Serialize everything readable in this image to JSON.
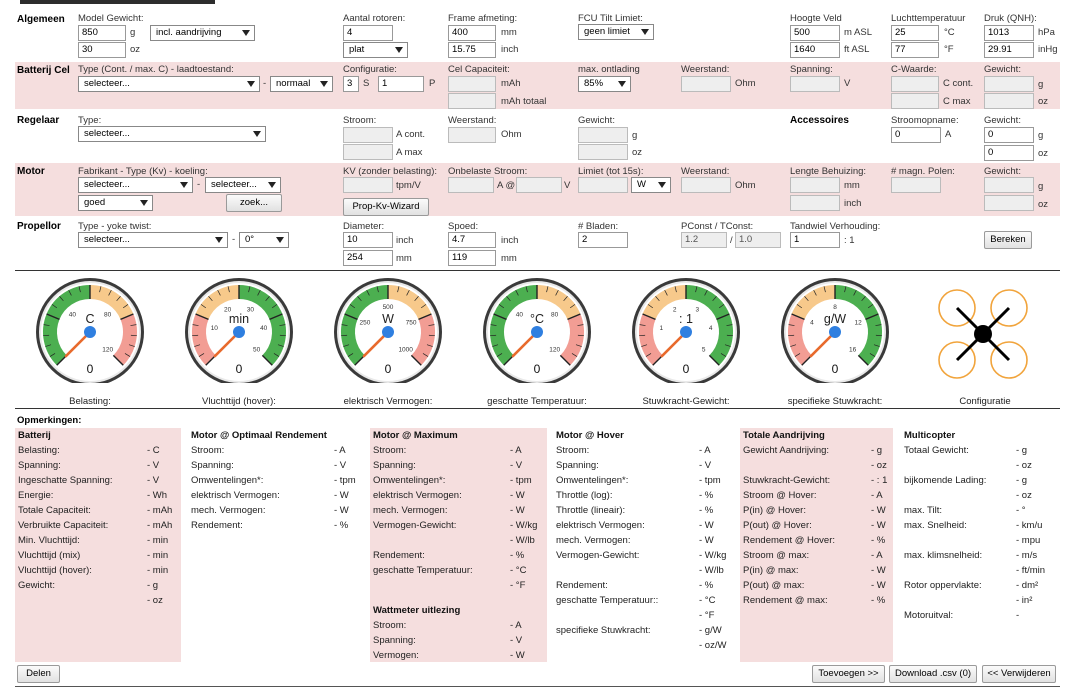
{
  "sections": {
    "general": "Algemeen",
    "battery": "Batterij Cel",
    "controller": "Regelaar",
    "motor": "Motor",
    "propeller": "Propellor",
    "accessories": "Accessoires"
  },
  "general": {
    "model_weight_label": "Model Gewicht:",
    "weight_g": "850",
    "weight_unit_g": "g",
    "weight_mode": "incl. aandrijving",
    "weight_oz": "30",
    "weight_unit_oz": "oz",
    "rotors_label": "Aantal rotoren:",
    "rotors": "4",
    "rotor_layout": "plat",
    "frame_label": "Frame afmeting:",
    "frame_mm": "400",
    "frame_mm_unit": "mm",
    "frame_inch": "15.75",
    "frame_inch_unit": "inch",
    "fcu_label": "FCU Tilt Limiet:",
    "fcu_value": "geen limiet",
    "field_label": "Hoogte Veld",
    "field_m": "500",
    "field_m_unit": "m ASL",
    "field_ft": "1640",
    "field_ft_unit": "ft ASL",
    "temp_label": "Luchttemperatuur",
    "temp_c": "25",
    "temp_c_unit": "°C",
    "temp_f": "77",
    "temp_f_unit": "°F",
    "pressure_label": "Druk (QNH):",
    "pressure_hpa": "1013",
    "pressure_hpa_unit": "hPa",
    "pressure_inhg": "29.91",
    "pressure_inhg_unit": "inHg"
  },
  "battery": {
    "type_label": "Type (Cont. / max. C) - laadtoestand:",
    "type_value": "selecteer...",
    "dash": "-",
    "charge_state": "normaal",
    "config_label": "Configuratie:",
    "cells_s": "3",
    "s_unit": "S",
    "cells_p": "1",
    "p_unit": "P",
    "capacity_label": "Cel Capaciteit:",
    "cap_unit": "mAh",
    "cap_total_unit": "mAh totaal",
    "discharge_label": "max. ontlading",
    "discharge_value": "85%",
    "resistance_label": "Weerstand:",
    "resistance_unit": "Ohm",
    "voltage_label": "Spanning:",
    "voltage_unit": "V",
    "c_label": "C-Waarde:",
    "c_cont_unit": "C cont.",
    "c_max_unit": "C max",
    "weight_label": "Gewicht:",
    "weight_unit_g": "g",
    "weight_unit_oz": "oz"
  },
  "controller": {
    "type_label": "Type:",
    "type_value": "selecteer...",
    "current_label": "Stroom:",
    "cont_unit": "A cont.",
    "max_unit": "A max",
    "resistance_label": "Weerstand:",
    "resistance_unit": "Ohm",
    "weight_label": "Gewicht:",
    "weight_unit_g": "g",
    "weight_unit_oz": "oz"
  },
  "accessories": {
    "current_label": "Stroomopname:",
    "current": "0",
    "current_unit": "A",
    "weight_label": "Gewicht:",
    "weight_g": "0",
    "weight_unit_g": "g",
    "weight_oz": "0",
    "weight_unit_oz": "oz"
  },
  "motor": {
    "type_label": "Fabrikant - Type (Kv) - koeling:",
    "manufacturer": "selecteer...",
    "dash": "-",
    "type_value": "selecteer...",
    "cooling": "goed",
    "search_button": "zoek...",
    "kv_label": "KV (zonder belasting):",
    "kv_unit": "tpm/V",
    "wizard_button": "Prop-Kv-Wizard",
    "noload_label": "Onbelaste Stroom:",
    "noload_a_unit": "A @",
    "noload_v_unit": "V",
    "limit_label": "Limiet (tot 15s):",
    "limit_unit": "W",
    "resistance_label": "Weerstand:",
    "resistance_unit": "Ohm",
    "length_label": "Lengte Behuizing:",
    "length_mm_unit": "mm",
    "length_inch_unit": "inch",
    "poles_label": "# magn. Polen:",
    "weight_label": "Gewicht:",
    "weight_unit_g": "g",
    "weight_unit_oz": "oz"
  },
  "propeller": {
    "type_label": "Type - yoke twist:",
    "type_value": "selecteer...",
    "dash": "-",
    "twist": "0°",
    "diameter_label": "Diameter:",
    "diameter_inch": "10",
    "diameter_inch_unit": "inch",
    "diameter_mm": "254",
    "diameter_mm_unit": "mm",
    "pitch_label": "Spoed:",
    "pitch_inch": "4.7",
    "pitch_inch_unit": "inch",
    "pitch_mm": "119",
    "pitch_mm_unit": "mm",
    "blades_label": "# Bladen:",
    "blades": "2",
    "pconst_label": "PConst / TConst:",
    "pconst": "1.2",
    "slash": "/",
    "tconst": "1.0",
    "gear_label": "Tandwiel Verhouding:",
    "gear": "1",
    "gear_unit": ": 1",
    "calc_button": "Bereken"
  },
  "gauges": [
    {
      "unit": "C",
      "value": "0",
      "caption": "Belasting:",
      "ticks": [
        "40",
        "80",
        "120"
      ],
      "colors": [
        "#4caf50",
        "#4caf50",
        "#f7c98b",
        "#f29d94"
      ]
    },
    {
      "unit": "min",
      "value": "0",
      "caption": "Vluchttijd (hover):",
      "ticks": [
        "10",
        "20",
        "30",
        "40",
        "50"
      ],
      "colors": [
        "#f29d94",
        "#f7c98b",
        "#4caf50",
        "#4caf50"
      ]
    },
    {
      "unit": "W",
      "value": "0",
      "caption": "elektrisch Vermogen:",
      "ticks": [
        "250",
        "500",
        "750",
        "1000"
      ],
      "colors": [
        "#4caf50",
        "#4caf50",
        "#f7c98b",
        "#f29d94"
      ]
    },
    {
      "unit": "°C",
      "value": "0",
      "caption": "geschatte Temperatuur:",
      "ticks": [
        "40",
        "80",
        "120"
      ],
      "colors": [
        "#4caf50",
        "#4caf50",
        "#f7c98b",
        "#f29d94"
      ]
    },
    {
      "unit": ": 1",
      "value": "0",
      "caption": "Stuwkracht-Gewicht:",
      "ticks": [
        "1",
        "2",
        "3",
        "4",
        "5"
      ],
      "colors": [
        "#f29d94",
        "#f7c98b",
        "#4caf50",
        "#4caf50"
      ]
    },
    {
      "unit": "g/W",
      "value": "0",
      "caption": "specifieke Stuwkracht:",
      "ticks": [
        "4",
        "8",
        "12",
        "16"
      ],
      "colors": [
        "#f29d94",
        "#f7c98b",
        "#4caf50",
        "#4caf50"
      ]
    }
  ],
  "config_caption": "Configuratie",
  "remarks_label": "Opmerkingen:",
  "results": [
    {
      "title": "Batterij",
      "pink": true,
      "rows": [
        {
          "k": "Belasting:",
          "v": "- C"
        },
        {
          "k": "Spanning:",
          "v": "- V"
        },
        {
          "k": "Ingeschatte Spanning:",
          "v": "- V"
        },
        {
          "k": "Energie:",
          "v": "- Wh"
        },
        {
          "k": "Totale Capaciteit:",
          "v": "- mAh"
        },
        {
          "k": "Verbruikte Capaciteit:",
          "v": "- mAh"
        },
        {
          "k": "Min. Vluchttijd:",
          "v": "- min"
        },
        {
          "k": "Vluchttijd (mix)",
          "v": "- min"
        },
        {
          "k": "Vluchttijd (hover):",
          "v": "- min"
        },
        {
          "k": "Gewicht:",
          "v": "- g"
        },
        {
          "k": "",
          "v": "- oz"
        }
      ]
    },
    {
      "title": "Motor @ Optimaal Rendement",
      "pink": false,
      "rows": [
        {
          "k": "Stroom:",
          "v": "- A"
        },
        {
          "k": "Spanning:",
          "v": "- V"
        },
        {
          "k": "Omwentelingen*:",
          "v": "- tpm"
        },
        {
          "k": "elektrisch Vermogen:",
          "v": "- W"
        },
        {
          "k": "mech. Vermogen:",
          "v": "- W"
        },
        {
          "k": "Rendement:",
          "v": "- %"
        }
      ]
    },
    {
      "title": "Motor @ Maximum",
      "pink": true,
      "rows": [
        {
          "k": "Stroom:",
          "v": "- A"
        },
        {
          "k": "Spanning:",
          "v": "- V"
        },
        {
          "k": "Omwentelingen*:",
          "v": "- tpm"
        },
        {
          "k": "elektrisch Vermogen:",
          "v": "- W"
        },
        {
          "k": "mech. Vermogen:",
          "v": "- W"
        },
        {
          "k": "Vermogen-Gewicht:",
          "v": "- W/kg"
        },
        {
          "k": "",
          "v": "- W/lb"
        },
        {
          "k": "Rendement:",
          "v": "- %"
        },
        {
          "k": "geschatte Temperatuur:",
          "v": "- °C"
        },
        {
          "k": "",
          "v": "- °F"
        }
      ]
    },
    {
      "title": "Motor @ Hover",
      "pink": false,
      "rows": [
        {
          "k": "Stroom:",
          "v": "- A"
        },
        {
          "k": "Spanning:",
          "v": "- V"
        },
        {
          "k": "Omwentelingen*:",
          "v": "- tpm"
        },
        {
          "k": "Throttle (log):",
          "v": "- %"
        },
        {
          "k": "Throttle (lineair):",
          "v": "- %"
        },
        {
          "k": "elektrisch Vermogen:",
          "v": "- W"
        },
        {
          "k": "mech. Vermogen:",
          "v": "- W"
        },
        {
          "k": "Vermogen-Gewicht:",
          "v": "- W/kg"
        },
        {
          "k": "",
          "v": "- W/lb"
        },
        {
          "k": "Rendement:",
          "v": "- %"
        },
        {
          "k": "geschatte Temperatuur::",
          "v": "- °C"
        },
        {
          "k": "",
          "v": "- °F"
        },
        {
          "k": "specifieke Stuwkracht:",
          "v": "- g/W"
        },
        {
          "k": "",
          "v": "- oz/W"
        }
      ]
    },
    {
      "title": "Totale Aandrijving",
      "pink": true,
      "rows": [
        {
          "k": "Gewicht Aandrijving:",
          "v": "- g"
        },
        {
          "k": "",
          "v": "- oz"
        },
        {
          "k": "Stuwkracht-Gewicht:",
          "v": "- : 1"
        },
        {
          "k": "Stroom @ Hover:",
          "v": "- A"
        },
        {
          "k": "P(in) @ Hover:",
          "v": "- W"
        },
        {
          "k": "P(out) @ Hover:",
          "v": "- W"
        },
        {
          "k": "Rendement @ Hover:",
          "v": "- %"
        },
        {
          "k": "Stroom @ max:",
          "v": "- A"
        },
        {
          "k": "P(in) @ max:",
          "v": "- W"
        },
        {
          "k": "P(out) @ max:",
          "v": "- W"
        },
        {
          "k": "Rendement @ max:",
          "v": "- %"
        }
      ]
    },
    {
      "title": "Multicopter",
      "pink": false,
      "rows": [
        {
          "k": "Totaal Gewicht:",
          "v": "- g"
        },
        {
          "k": "",
          "v": "- oz"
        },
        {
          "k": "bijkomende Lading:",
          "v": "- g"
        },
        {
          "k": "",
          "v": "- oz"
        },
        {
          "k": "max. Tilt:",
          "v": "- °"
        },
        {
          "k": "max. Snelheid:",
          "v": "- km/u"
        },
        {
          "k": "",
          "v": "- mpu"
        },
        {
          "k": "max. klimsnelheid:",
          "v": "- m/s"
        },
        {
          "k": "",
          "v": "- ft/min"
        },
        {
          "k": "Rotor oppervlakte:",
          "v": "- dm²"
        },
        {
          "k": "",
          "v": "- in²"
        },
        {
          "k": "Motoruitval:",
          "v": "-"
        }
      ]
    }
  ],
  "sub_results": {
    "title": "Wattmeter uitlezing",
    "rows": [
      {
        "k": "Stroom:",
        "v": "- A"
      },
      {
        "k": "Spanning:",
        "v": "- V"
      },
      {
        "k": "Vermogen:",
        "v": "- W"
      }
    ]
  },
  "footer": {
    "share": "Delen",
    "add": "Toevoegen >>",
    "download": "Download .csv (0)",
    "delete": "<< Verwijderen"
  }
}
